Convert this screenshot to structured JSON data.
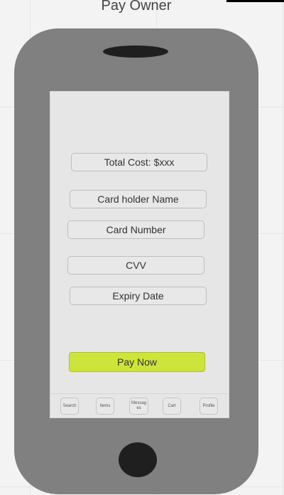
{
  "page": {
    "title": "Pay Owner"
  },
  "form": {
    "total_cost": "Total Cost: $xxx",
    "card_holder_name": "Card holder Name",
    "card_number": "Card Number",
    "cvv": "CVV",
    "expiry_date": "Expiry Date",
    "pay_button_label": "Pay Now"
  },
  "bottom_nav": {
    "items": [
      {
        "label": "Search"
      },
      {
        "label": "Items"
      },
      {
        "label": "Messages"
      },
      {
        "label": "Cart"
      },
      {
        "label": "Profile"
      }
    ]
  },
  "colors": {
    "accent": "#cde53a",
    "phone_body": "#808080",
    "screen": "#e6e6e6"
  }
}
